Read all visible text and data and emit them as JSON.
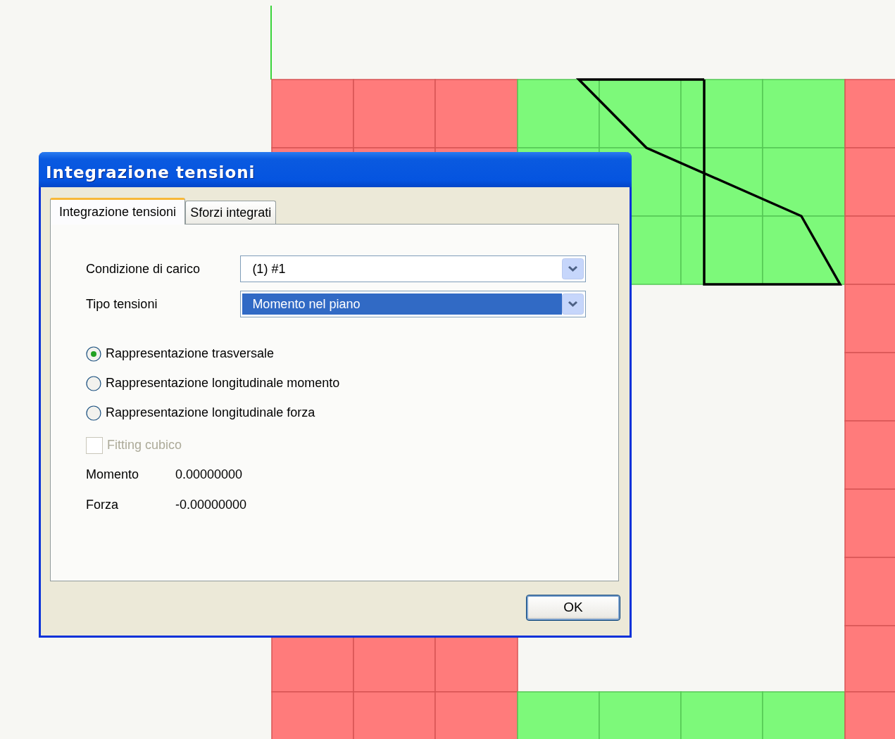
{
  "dialog": {
    "title": "Integrazione tensioni"
  },
  "tabs": [
    {
      "label": "Integrazione tensioni",
      "selected": true
    },
    {
      "label": "Sforzi integrati",
      "selected": false
    }
  ],
  "fields": [
    {
      "label": "Condizione di carico",
      "value": "(1) #1",
      "highlighted": false
    },
    {
      "label": "Tipo tensioni",
      "value": "Momento nel piano",
      "highlighted": true
    }
  ],
  "options": [
    {
      "label": "Rappresentazione trasversale",
      "selected": true
    },
    {
      "label": "Rappresentazione longitudinale momento",
      "selected": false
    },
    {
      "label": "Rappresentazione longitudinale forza",
      "selected": false
    }
  ],
  "checkbox": {
    "label": "Fitting cubico",
    "checked": false,
    "disabled": true
  },
  "results": [
    {
      "label": "Momento",
      "value": "0.00000000"
    },
    {
      "label": "Forza",
      "value": "-0.00000000"
    }
  ],
  "buttons": [
    "OK"
  ]
}
